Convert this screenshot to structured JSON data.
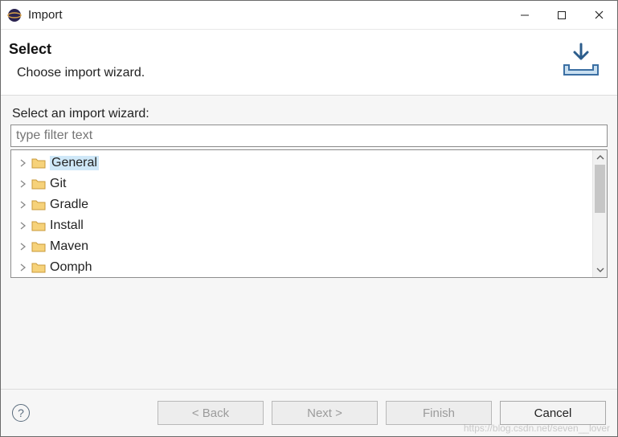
{
  "titlebar": {
    "title": "Import"
  },
  "header": {
    "page_title": "Select",
    "page_desc": "Choose import wizard."
  },
  "section": {
    "label": "Select an import wizard:",
    "filter_placeholder": "type filter text"
  },
  "tree": {
    "items": [
      {
        "label": "General",
        "selected": true
      },
      {
        "label": "Git"
      },
      {
        "label": "Gradle"
      },
      {
        "label": "Install"
      },
      {
        "label": "Maven"
      },
      {
        "label": "Oomph"
      }
    ]
  },
  "buttons": {
    "back": "< Back",
    "next": "Next >",
    "finish": "Finish",
    "cancel": "Cancel"
  },
  "watermark": "https://blog.csdn.net/seven__lover"
}
